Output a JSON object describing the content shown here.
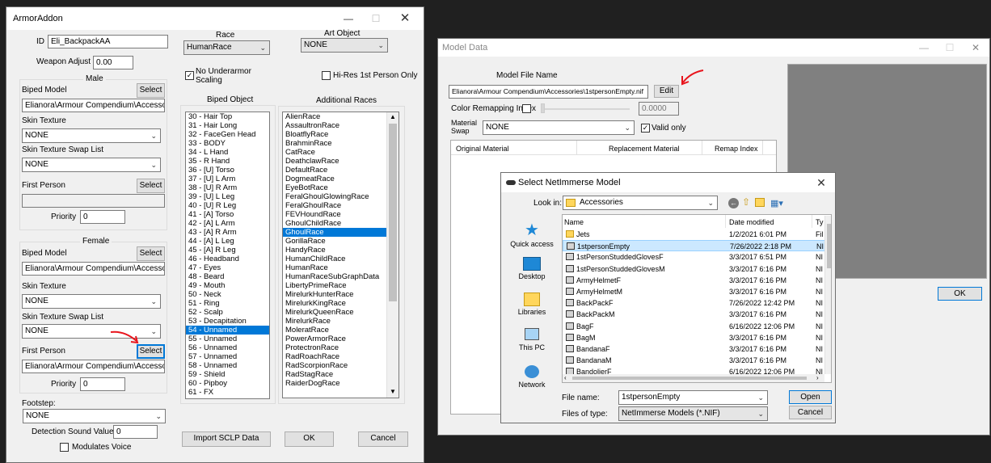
{
  "armor": {
    "title": "ArmorAddon",
    "id_label": "ID",
    "id_value": "Eli_BackpackAA",
    "weapon_adjust_label": "Weapon Adjust",
    "weapon_adjust_value": "0.00",
    "race_label": "Race",
    "race_value": "HumanRace",
    "art_object_label": "Art Object",
    "art_object_value": "NONE",
    "no_underarmor_label": "No Underarmor\nScaling",
    "hires_label": "Hi-Res 1st Person Only",
    "male": {
      "title": "Male",
      "biped_model_label": "Biped Model",
      "select_label": "Select",
      "biped_model_path": "Elianora\\Armour Compendium\\Accessories",
      "skin_texture_label": "Skin Texture",
      "skin_texture_value": "NONE",
      "swap_list_label": "Skin Texture Swap List",
      "swap_list_value": "NONE",
      "first_person_label": "First Person",
      "first_person_path": "",
      "priority_label": "Priority",
      "priority_value": "0"
    },
    "female": {
      "title": "Female",
      "biped_model_label": "Biped Model",
      "select_label": "Select",
      "biped_model_path": "Elianora\\Armour Compendium\\Accessories",
      "skin_texture_label": "Skin Texture",
      "skin_texture_value": "NONE",
      "swap_list_label": "Skin Texture Swap List",
      "swap_list_value": "NONE",
      "first_person_label": "First Person",
      "first_person_path": "Elianora\\Armour Compendium\\Accessories",
      "priority_label": "Priority",
      "priority_value": "0"
    },
    "footstep_label": "Footstep:",
    "footstep_value": "NONE",
    "detection_label": "Detection Sound Value",
    "detection_value": "0",
    "modulates_label": "Modulates Voice",
    "biped_object_title": "Biped Object",
    "biped_objects": [
      "30 - Hair Top",
      "31 - Hair Long",
      "32 - FaceGen Head",
      "33 - BODY",
      "34 - L Hand",
      "35 - R Hand",
      "36 - [U] Torso",
      "37 - [U] L Arm",
      "38 - [U] R Arm",
      "39 - [U] L Leg",
      "40 - [U] R Leg",
      "41 - [A] Torso",
      "42 - [A] L Arm",
      "43 - [A] R Arm",
      "44 - [A] L Leg",
      "45 - [A] R Leg",
      "46 - Headband",
      "47 - Eyes",
      "48 - Beard",
      "49 - Mouth",
      "50 - Neck",
      "51 - Ring",
      "52 - Scalp",
      "53 - Decapitation",
      "54 - Unnamed",
      "55 - Unnamed",
      "56 - Unnamed",
      "57 - Unnamed",
      "58 - Unnamed",
      "59 - Shield",
      "60 - Pipboy",
      "61 - FX"
    ],
    "biped_selected_index": 24,
    "additional_races_title": "Additional Races",
    "races": [
      "AlienRace",
      "AssaultronRace",
      "BloatflyRace",
      "BrahminRace",
      "CatRace",
      "DeathclawRace",
      "DefaultRace",
      "DogmeatRace",
      "EyeBotRace",
      "FeralGhoulGlowingRace",
      "FeralGhoulRace",
      "FEVHoundRace",
      "GhoulChildRace",
      "GhoulRace",
      "GorillaRace",
      "HandyRace",
      "HumanChildRace",
      "HumanRace",
      "HumanRaceSubGraphData",
      "LibertyPrimeRace",
      "MirelurkHunterRace",
      "MirelurkKingRace",
      "MirelurkQueenRace",
      "MirelurkRace",
      "MoleratRace",
      "PowerArmorRace",
      "ProtectronRace",
      "RadRoachRace",
      "RadScorpionRace",
      "RadStagRace",
      "RaiderDogRace"
    ],
    "race_selected_index": 13,
    "import_label": "Import SCLP Data",
    "ok_label": "OK",
    "cancel_label": "Cancel"
  },
  "model": {
    "title": "Model Data",
    "file_name_label": "Model File Name",
    "file_name_value": "Elianora\\Armour Compendium\\Accessories\\1stpersonEmpty.nif",
    "edit_label": "Edit",
    "color_remap_label": "Color Remapping Index",
    "color_remap_value": "0.0000",
    "material_swap_label": "Material\nSwap",
    "material_swap_value": "NONE",
    "valid_only_label": "Valid only",
    "columns": [
      "Original Material",
      "Replacement Material",
      "Remap Index"
    ],
    "ok_label": "OK"
  },
  "dialog": {
    "title": "Select NetImmerse Model",
    "look_in_label": "Look in:",
    "look_in_value": "Accessories",
    "places": [
      "Quick access",
      "Desktop",
      "Libraries",
      "This PC",
      "Network"
    ],
    "col_name": "Name",
    "col_date": "Date modified",
    "col_type": "Ty",
    "files": [
      {
        "name": "Jets",
        "date": "1/2/2021 6:01 PM",
        "type": "Fil",
        "folder": true
      },
      {
        "name": "1stpersonEmpty",
        "date": "7/26/2022 2:18 PM",
        "type": "NI",
        "folder": false
      },
      {
        "name": "1stPersonStuddedGlovesF",
        "date": "3/3/2017 6:51 PM",
        "type": "NI",
        "folder": false
      },
      {
        "name": "1stPersonStuddedGlovesM",
        "date": "3/3/2017 6:16 PM",
        "type": "NI",
        "folder": false
      },
      {
        "name": "ArmyHelmetF",
        "date": "3/3/2017 6:16 PM",
        "type": "NI",
        "folder": false
      },
      {
        "name": "ArmyHelmetM",
        "date": "3/3/2017 6:16 PM",
        "type": "NI",
        "folder": false
      },
      {
        "name": "BackPackF",
        "date": "7/26/2022 12:42 PM",
        "type": "NI",
        "folder": false
      },
      {
        "name": "BackPackM",
        "date": "3/3/2017 6:16 PM",
        "type": "NI",
        "folder": false
      },
      {
        "name": "BagF",
        "date": "6/16/2022 12:06 PM",
        "type": "NI",
        "folder": false
      },
      {
        "name": "BagM",
        "date": "3/3/2017 6:16 PM",
        "type": "NI",
        "folder": false
      },
      {
        "name": "BandanaF",
        "date": "3/3/2017 6:16 PM",
        "type": "NI",
        "folder": false
      },
      {
        "name": "BandanaM",
        "date": "3/3/2017 6:16 PM",
        "type": "NI",
        "folder": false
      },
      {
        "name": "BandolierF",
        "date": "6/16/2022 12:06 PM",
        "type": "NI",
        "folder": false
      }
    ],
    "selected_file_index": 1,
    "file_name_label": "File name:",
    "file_name_value": "1stpersonEmpty",
    "file_type_label": "Files of type:",
    "file_type_value": "NetImmerse Models (*.NIF)",
    "open_label": "Open",
    "cancel_label": "Cancel"
  },
  "colors": {
    "selection": "#0078d7",
    "arrow": "#e8141c",
    "preview": "#808080"
  }
}
